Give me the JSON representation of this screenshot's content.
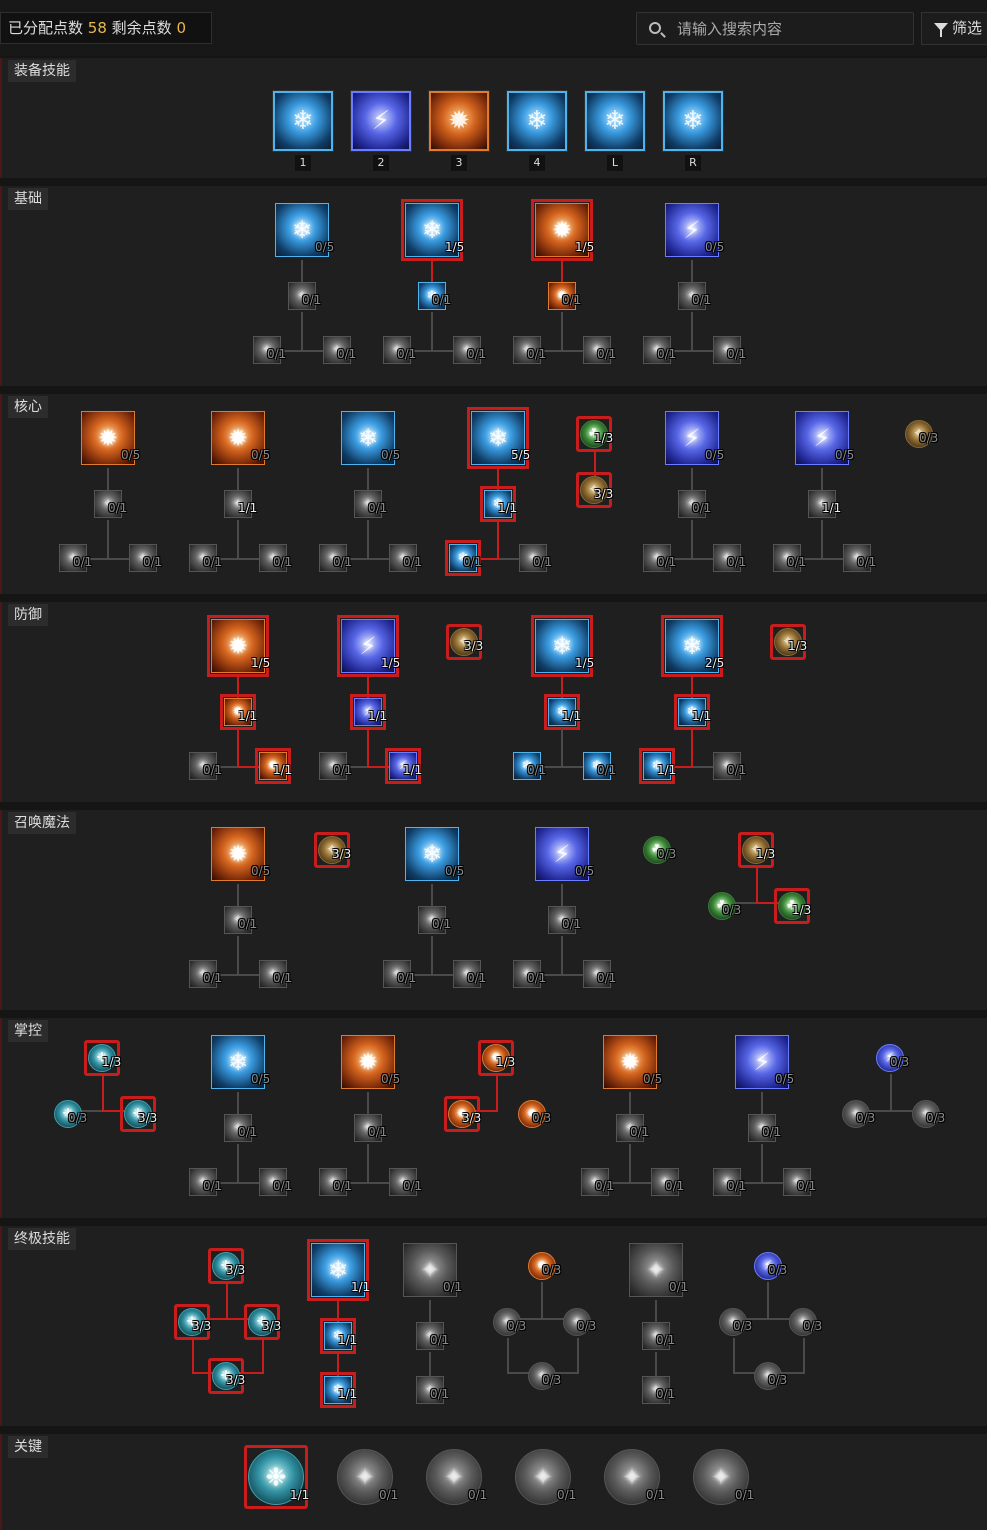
{
  "header": {
    "points_allocated_label": "已分配点数",
    "points_allocated": "58",
    "points_remaining_label": "剩余点数",
    "points_remaining": "0",
    "search_placeholder": "请输入搜索内容",
    "filter_label": "筛选"
  },
  "equipped": {
    "label": "装备技能",
    "keys": [
      "1",
      "2",
      "3",
      "4",
      "L",
      "R"
    ],
    "icons": [
      "frost-nova-icon",
      "ice-armor-icon",
      "flame-shield-icon",
      "ice-shield-icon",
      "deep-freeze-icon",
      "ice-shards-icon"
    ]
  },
  "sections": [
    {
      "label": "基础",
      "icons": [
        "frost-bolt-icon",
        "ice-shard-bolt-icon",
        "fire-spear-icon",
        "arc-lash-icon"
      ]
    },
    {
      "label": "核心",
      "icons": [
        "incinerate-icon",
        "fireball-icon",
        "frozen-orb-icon",
        "ice-shards-icon",
        "chain-lightning-icon",
        "charged-bolts-icon"
      ]
    },
    {
      "label": "防御",
      "icons": [
        "flame-shield-icon",
        "ice-armor-icon",
        "frost-shield-icon",
        "frost-nova-icon"
      ]
    },
    {
      "label": "召唤魔法",
      "icons": [
        "hydra-icon",
        "ice-blades-icon",
        "lightning-spear-icon"
      ]
    },
    {
      "label": "掌控",
      "icons": [
        "ice-vortex-icon",
        "fire-orb-icon",
        "firewall-icon",
        "blizzard-icon"
      ]
    },
    {
      "label": "终极技能",
      "icons": [
        "deep-freeze-icon",
        "inferno-icon",
        "unstable-current-icon"
      ]
    },
    {
      "label": "关键",
      "icons": [
        "esu-blessing-icon",
        "shatter-icon",
        "overflow-icon",
        "crackling-icon",
        "vyr-icon",
        "burn-icon"
      ]
    }
  ],
  "ranks": {
    "s1": [
      "0/5",
      "1/5",
      "1/5",
      "0/5",
      "0/1",
      "0/1",
      "0/1",
      "0/1",
      "0/1",
      "0/1",
      "0/1",
      "0/1",
      "0/1",
      "0/1",
      "0/1",
      "0/1"
    ],
    "s2": [
      "0/5",
      "0/5",
      "0/5",
      "5/5",
      "1/3",
      "3/3",
      "0/5",
      "0/5",
      "0/3",
      "0/1",
      "0/1",
      "0/1",
      "1/1",
      "0/1",
      "0/1",
      "0/1",
      "0/1",
      "0/1",
      "0/1",
      "0/1",
      "0/1",
      "1/1",
      "0/1",
      "0/1",
      "0/1",
      "0/1",
      "0/1"
    ],
    "s3": [
      "1/5",
      "1/5",
      "3/3",
      "1/5",
      "2/5",
      "1/3",
      "1/1",
      "1/1",
      "1/1",
      "1/1",
      "0/1",
      "1/1",
      "0/1",
      "1/1",
      "0/1",
      "0/1",
      "1/1",
      "0/1"
    ],
    "s4": [
      "0/5",
      "3/3",
      "0/5",
      "0/5",
      "0/3",
      "1/3",
      "0/3",
      "1/3",
      "0/1",
      "0/1",
      "0/1",
      "0/1",
      "0/1",
      "0/1",
      "0/1",
      "0/1",
      "0/1"
    ],
    "s5": [
      "1/3",
      "0/3",
      "3/3",
      "0/5",
      "0/5",
      "1/3",
      "3/3",
      "0/3",
      "0/5",
      "0/5",
      "0/3",
      "0/3",
      "0/3",
      "0/1",
      "0/1",
      "0/1",
      "0/1",
      "0/1",
      "0/1",
      "0/1",
      "0/1",
      "0/1",
      "0/1",
      "0/1",
      "0/1"
    ],
    "s6": [
      "3/3",
      "3/3",
      "3/3",
      "3/3",
      "1/1",
      "1/1",
      "1/1",
      "0/1",
      "0/1",
      "0/1",
      "0/3",
      "0/3",
      "0/3",
      "0/3",
      "0/1",
      "0/1",
      "0/1",
      "0/3",
      "0/3",
      "0/3",
      "0/3"
    ],
    "s7": [
      "1/1",
      "0/1",
      "0/1",
      "0/1",
      "0/1",
      "0/1"
    ]
  },
  "colors": {
    "accent_points": "#e8b84a",
    "selected_outline": "#c91c1c",
    "frost": "#2e8fcf",
    "fire": "#c5541c",
    "shock": "#3040c0"
  }
}
